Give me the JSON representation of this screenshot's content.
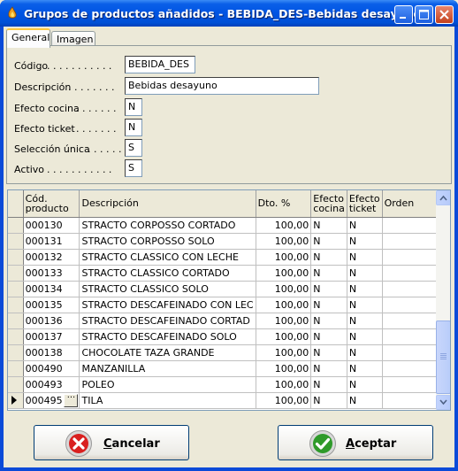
{
  "window": {
    "title": "Grupos de productos añadidos - BEBIDA_DES-Bebidas desayuno"
  },
  "tabs": [
    {
      "label": "General",
      "active": true
    },
    {
      "label": "Imagen",
      "active": false
    }
  ],
  "form": {
    "codigo": {
      "label": "Código",
      "dots": ". . . . . . . . . . .",
      "value": "BEBIDA_DES"
    },
    "descripcion": {
      "label": "Descripción",
      "dots": ". . . . . . . .",
      "value": "Bebidas desayuno"
    },
    "efecto_cocina": {
      "label": "Efecto cocina",
      "dots": ". . . . . . .",
      "value": "N"
    },
    "efecto_ticket": {
      "label": "Efecto ticket",
      "dots": ". . . . . . .",
      "value": "N"
    },
    "seleccion_unica": {
      "label": "Selección única",
      "dots": ". . . . . .",
      "value": "S"
    },
    "activo": {
      "label": "Activo",
      "dots": ". . . . . . . . . . .",
      "value": "S"
    }
  },
  "grid": {
    "headers": {
      "cod": "Cód.\nproducto",
      "desc": "Descripción",
      "dto": "Dto. %",
      "cocina": "Efecto\ncocina",
      "ticket": "Efecto\nticket",
      "orden": "Orden"
    },
    "rows": [
      {
        "cod": "000130",
        "desc": "STRACTO CORPOSSO CORTADO",
        "dto": "100,00",
        "cocina": "N",
        "ticket": "N",
        "orden": ""
      },
      {
        "cod": "000131",
        "desc": "STRACTO CORPOSSO SOLO",
        "dto": "100,00",
        "cocina": "N",
        "ticket": "N",
        "orden": ""
      },
      {
        "cod": "000132",
        "desc": "STRACTO CLASSICO CON LECHE",
        "dto": "100,00",
        "cocina": "N",
        "ticket": "N",
        "orden": ""
      },
      {
        "cod": "000133",
        "desc": "STRACTO CLASSICO CORTADO",
        "dto": "100,00",
        "cocina": "N",
        "ticket": "N",
        "orden": ""
      },
      {
        "cod": "000134",
        "desc": "STRACTO CLASSICO SOLO",
        "dto": "100,00",
        "cocina": "N",
        "ticket": "N",
        "orden": ""
      },
      {
        "cod": "000135",
        "desc": "STRACTO DESCAFEINADO CON LEC",
        "dto": "100,00",
        "cocina": "N",
        "ticket": "N",
        "orden": ""
      },
      {
        "cod": "000136",
        "desc": "STRACTO DESCAFEINADO CORTAD",
        "dto": "100,00",
        "cocina": "N",
        "ticket": "N",
        "orden": ""
      },
      {
        "cod": "000137",
        "desc": "STRACTO DESCAFEINADO SOLO",
        "dto": "100,00",
        "cocina": "N",
        "ticket": "N",
        "orden": ""
      },
      {
        "cod": "000138",
        "desc": "CHOCOLATE TAZA GRANDE",
        "dto": "100,00",
        "cocina": "N",
        "ticket": "N",
        "orden": ""
      },
      {
        "cod": "000490",
        "desc": "MANZANILLA",
        "dto": "100,00",
        "cocina": "N",
        "ticket": "N",
        "orden": ""
      },
      {
        "cod": "000493",
        "desc": "POLEO",
        "dto": "100,00",
        "cocina": "N",
        "ticket": "N",
        "orden": ""
      },
      {
        "cod": "000495",
        "desc": "TILA",
        "dto": "100,00",
        "cocina": "N",
        "ticket": "N",
        "orden": "",
        "current": true,
        "ellipsis": "···"
      }
    ]
  },
  "buttons": {
    "cancel": {
      "label": "Cancelar",
      "icon": "cancel-x-icon",
      "color": "#d92020"
    },
    "accept": {
      "label": "Aceptar",
      "icon": "check-icon",
      "color": "#2f9a2a"
    }
  }
}
